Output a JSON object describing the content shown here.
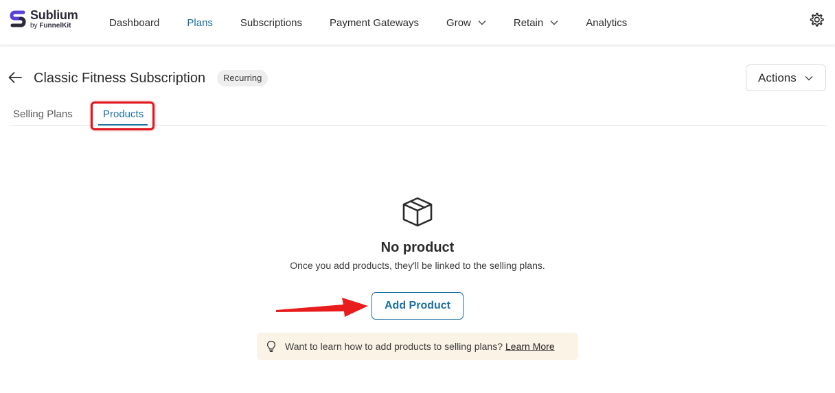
{
  "brand": {
    "name": "Sublium",
    "sub_prefix": "by ",
    "sub_brand": "FunnelKit"
  },
  "nav": {
    "items": [
      {
        "label": "Dashboard"
      },
      {
        "label": "Plans"
      },
      {
        "label": "Subscriptions"
      },
      {
        "label": "Payment Gateways"
      },
      {
        "label": "Grow"
      },
      {
        "label": "Retain"
      },
      {
        "label": "Analytics"
      }
    ],
    "active": "Plans"
  },
  "header": {
    "title": "Classic Fitness Subscription",
    "badge": "Recurring",
    "actions_label": "Actions"
  },
  "tabs": [
    {
      "label": "Selling Plans"
    },
    {
      "label": "Products"
    }
  ],
  "empty_state": {
    "title": "No product",
    "description": "Once you add products, they'll be linked to the selling plans.",
    "button_label": "Add Product"
  },
  "hint": {
    "text": "Want to learn how to add products to selling plans?",
    "link_label": "Learn More"
  },
  "colors": {
    "accent": "#1b6fa3",
    "annotation_red": "#e0141d",
    "hint_bg": "#fcf3e7",
    "brand_purple": "#5b3fd6"
  }
}
